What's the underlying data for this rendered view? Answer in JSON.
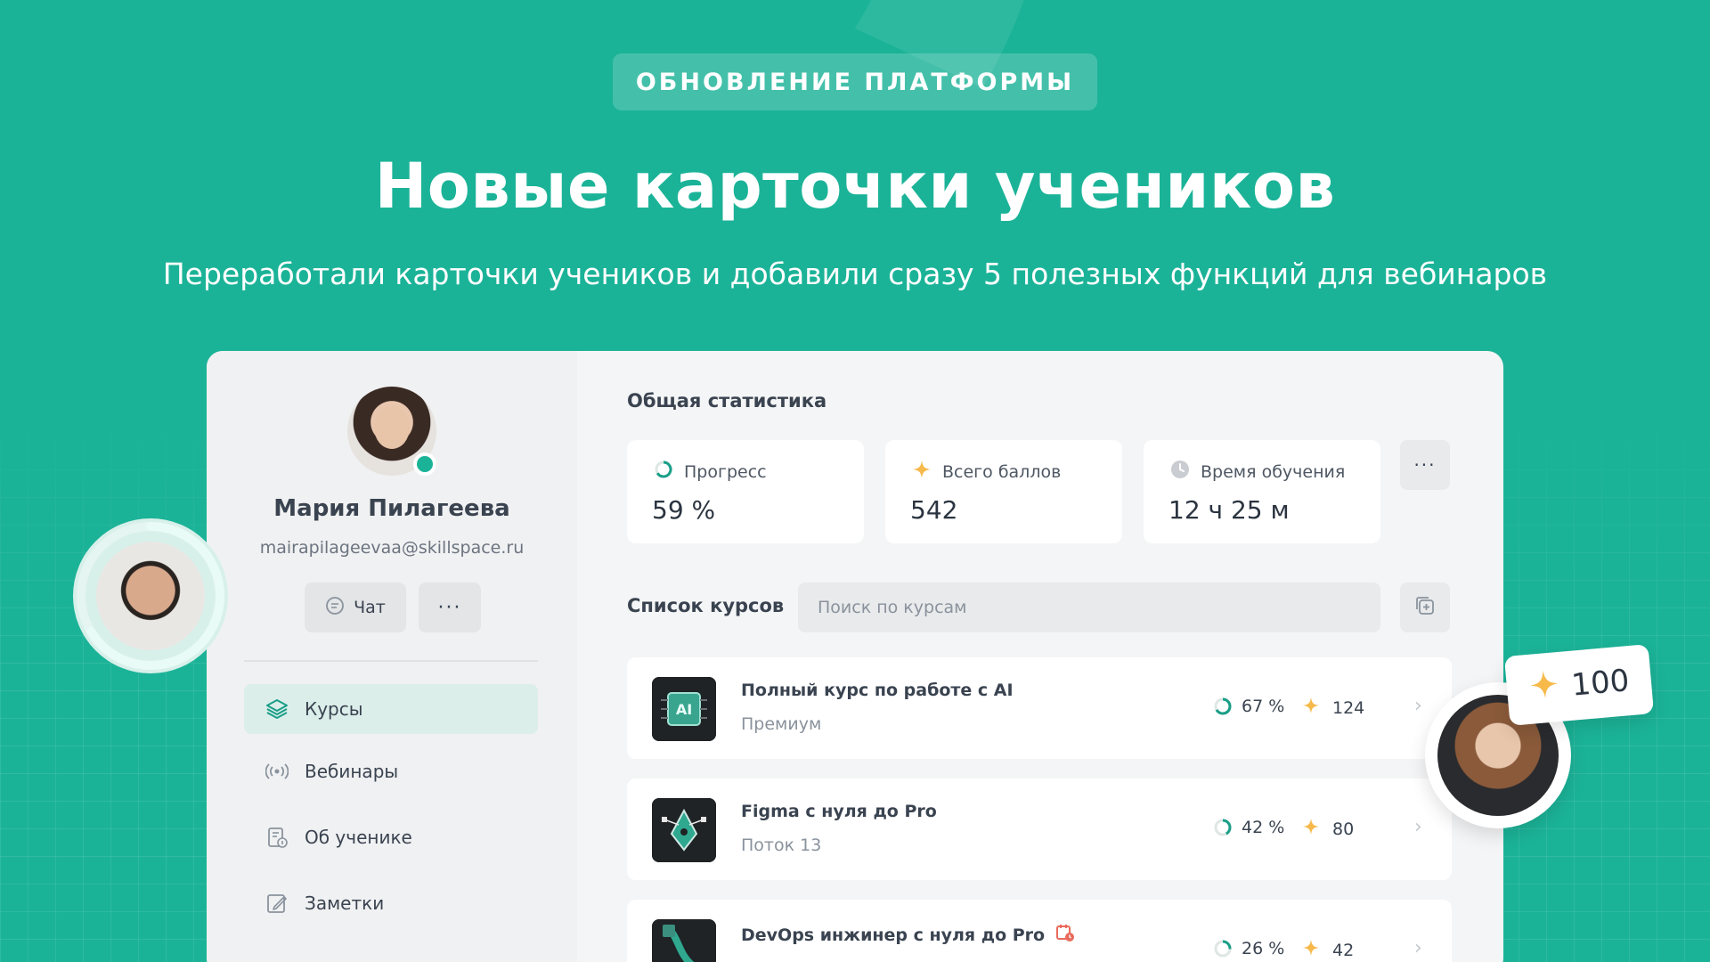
{
  "banner": {
    "tag": "ОБНОВЛЕНИЕ ПЛАТФОРМЫ",
    "title": "Новые карточки учеников",
    "subtitle": "Переработали карточки учеников и добавили сразу 5 полезных функций для вебинаров"
  },
  "profile": {
    "name": "Мария Пилагеева",
    "email": "mairapilageevaa@skillspace.ru",
    "chat_label": "Чат",
    "more_label": "···"
  },
  "nav": {
    "items": [
      {
        "label": "Курсы",
        "icon": "layers-icon",
        "active": true
      },
      {
        "label": "Вебинары",
        "icon": "broadcast-icon",
        "active": false
      },
      {
        "label": "Об ученике",
        "icon": "student-info-icon",
        "active": false
      },
      {
        "label": "Заметки",
        "icon": "notes-icon",
        "active": false
      }
    ]
  },
  "stats": {
    "title": "Общая статистика",
    "more_label": "···",
    "cards": [
      {
        "label": "Прогресс",
        "value": "59 %",
        "icon": "progress-ring-icon"
      },
      {
        "label": "Всего баллов",
        "value": "542",
        "icon": "star-icon"
      },
      {
        "label": "Время обучения",
        "value": "12 ч 25 м",
        "icon": "clock-icon"
      }
    ]
  },
  "courses": {
    "title": "Список курсов",
    "search_placeholder": "Поиск по курсам",
    "items": [
      {
        "title": "Полный курс по работе с AI",
        "subtitle": "Премиум",
        "progress": "67 %",
        "progress_value": 67,
        "points": "124"
      },
      {
        "title": "Figma с нуля до Pro",
        "subtitle": "Поток 13",
        "progress": "42 %",
        "progress_value": 42,
        "points": "80"
      },
      {
        "title": "DevOps инжинер с нуля до Pro",
        "subtitle": "",
        "progress": "26 %",
        "progress_value": 26,
        "points": "42"
      }
    ]
  },
  "badge": {
    "points": "100"
  },
  "colors": {
    "brand": "#1bb398",
    "star": "#f6b94a",
    "accent": "#1a9e88"
  }
}
